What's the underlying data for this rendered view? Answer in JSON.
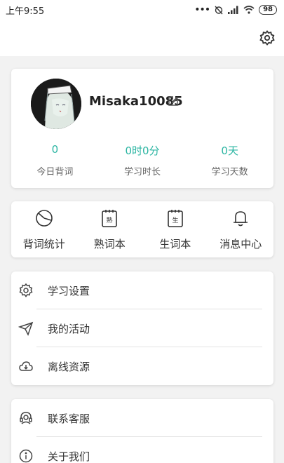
{
  "status_bar": {
    "time": "上午9:55",
    "battery": "98"
  },
  "header": {
    "settings_icon": "gear-icon"
  },
  "profile": {
    "username": "Misaka10085",
    "edit_icon": "edit-icon",
    "stats": [
      {
        "value": "0",
        "label": "今日背词"
      },
      {
        "value": "0时0分",
        "label": "学习时长"
      },
      {
        "value": "0天",
        "label": "学习天数"
      }
    ]
  },
  "shortcuts": [
    {
      "label": "背词统计",
      "icon": "pie-chart-icon"
    },
    {
      "label": "熟词本",
      "icon": "familiar-words-book-icon",
      "glyph": "熟"
    },
    {
      "label": "生词本",
      "icon": "new-words-book-icon",
      "glyph": "生"
    },
    {
      "label": "消息中心",
      "icon": "bell-icon"
    }
  ],
  "menu": [
    {
      "label": "学习设置",
      "icon": "gear-icon"
    },
    {
      "label": "我的活动",
      "icon": "paper-plane-icon"
    },
    {
      "label": "离线资源",
      "icon": "cloud-download-icon"
    }
  ],
  "menu2": [
    {
      "label": "联系客服",
      "icon": "headset-icon"
    },
    {
      "label": "关于我们",
      "icon": "info-icon"
    }
  ],
  "colors": {
    "accent": "#2bb5a2",
    "background": "#f2f2f2",
    "card": "#ffffff"
  }
}
